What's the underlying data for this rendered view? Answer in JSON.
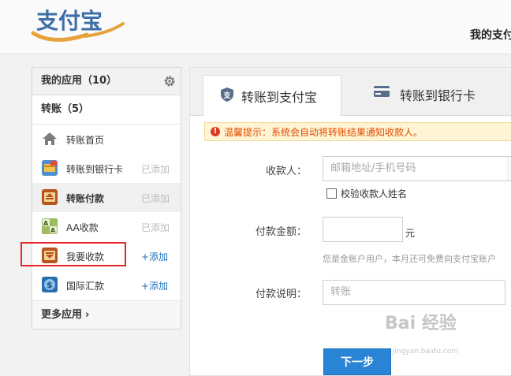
{
  "header": {
    "logo_text": "支付宝",
    "right_title": "我的支付宝"
  },
  "sidebar": {
    "my_apps": "我的应用（10）",
    "section": "转账（5）",
    "items": [
      {
        "label": "转账首页",
        "status": "",
        "icon": "home-icon"
      },
      {
        "label": "转账到银行卡",
        "status": "已添加",
        "icon": "bank-card-icon"
      },
      {
        "label": "转账付款",
        "status": "已添加",
        "icon": "transfer-pay-icon"
      },
      {
        "label": "AA收款",
        "status": "已添加",
        "icon": "aa-collect-icon"
      },
      {
        "label": "我要收款",
        "status": "+添加",
        "icon": "collect-icon"
      },
      {
        "label": "国际汇款",
        "status": "+添加",
        "icon": "international-remit-icon"
      }
    ],
    "more": "更多应用",
    "more_chevron": "›"
  },
  "tabs": [
    {
      "label": "转账到支付宝",
      "icon": "alipay-shield-icon"
    },
    {
      "label": "转账到银行卡",
      "icon": "bank-card-icon"
    }
  ],
  "notice": {
    "icon": "!",
    "text": "温馨提示：系统会自动将转账结果通知收款人。"
  },
  "form": {
    "payee_label": "收款人：",
    "payee_placeholder": "邮箱地址/手机号码",
    "verify_label": "校验收款人姓名",
    "amount_label": "付款金额：",
    "amount_value": "",
    "unit": "元",
    "hint": "您是金账户用户，本月还可免费向支付宝账户",
    "memo_label": "付款说明：",
    "memo_placeholder": "转账",
    "next_button": "下一步"
  },
  "watermark": {
    "text": "Bai 经验",
    "sub": "jingyan.baidu.com"
  }
}
